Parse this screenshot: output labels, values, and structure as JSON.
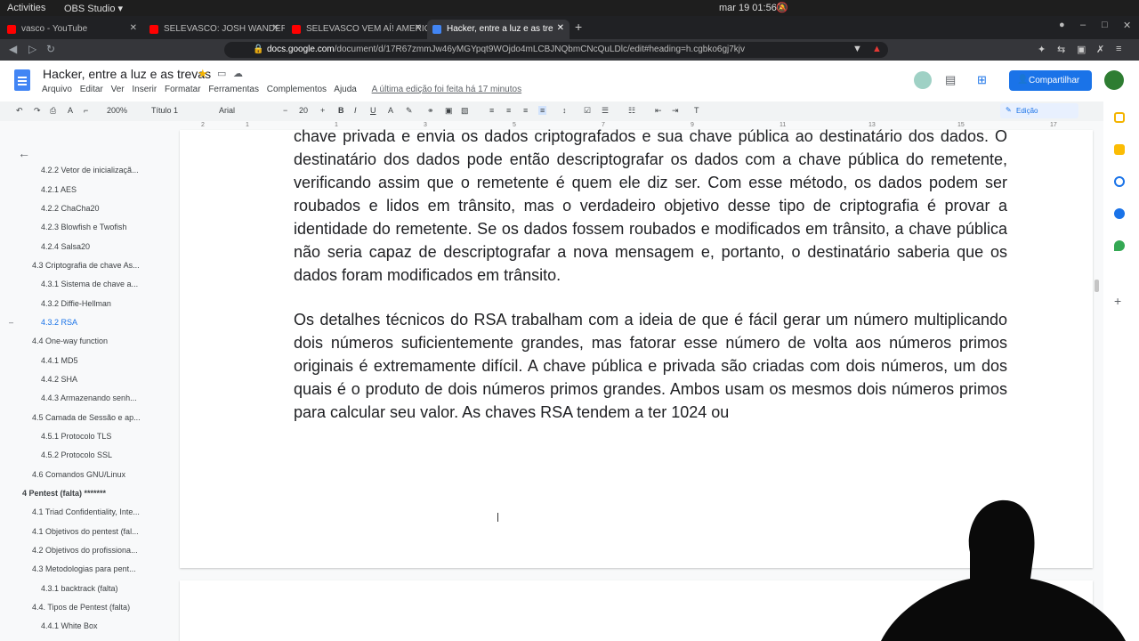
{
  "system": {
    "activities": "Activities",
    "app": "OBS Studio ▾",
    "clock": "mar 19  01:56"
  },
  "tabs": [
    {
      "label": "vasco - YouTube",
      "color": "#ff0000"
    },
    {
      "label": "SELEVASCO: JOSH WANDER",
      "color": "#ff0000"
    },
    {
      "label": "SELEVASCO VEM AÍ! AMERIC",
      "color": "#ff0000"
    },
    {
      "label": "Hacker, entre a luz e as tre",
      "color": "#4285f4"
    }
  ],
  "address": {
    "host": "docs.google.com",
    "path": "/document/d/17R67zmmJw46yMGYpqt9WOjdo4mLCBJNQbmCNcQuLDlc/edit#heading=h.cgbko6gj7kjv"
  },
  "doc": {
    "title": "Hacker, entre a luz e as trevas",
    "menus": [
      "Arquivo",
      "Editar",
      "Ver",
      "Inserir",
      "Formatar",
      "Ferramentas",
      "Complementos",
      "Ajuda"
    ],
    "last_edit": "A última edição foi feita há 17 minutos",
    "share_label": "Compartilhar"
  },
  "toolbar": {
    "zoom": "200%",
    "style": "Título 1",
    "font": "Arial",
    "size": "20",
    "mode": "Edição"
  },
  "outline": [
    {
      "label": "4.2.2 Vetor de inicializaçã...",
      "level": 3
    },
    {
      "label": "4.2.1 AES",
      "level": 3
    },
    {
      "label": "4.2.2 ChaCha20",
      "level": 3
    },
    {
      "label": "4.2.3 Blowfish e Twofish",
      "level": 3
    },
    {
      "label": "4.2.4 Salsa20",
      "level": 3
    },
    {
      "label": "4.3 Criptografia de chave As...",
      "level": 2
    },
    {
      "label": "4.3.1 Sistema de chave a...",
      "level": 3
    },
    {
      "label": "4.3.2 Diffie-Hellman",
      "level": 3
    },
    {
      "label": "4.3.2 RSA",
      "level": 3,
      "selected": true
    },
    {
      "label": "4.4 One-way function",
      "level": 2
    },
    {
      "label": "4.4.1 MD5",
      "level": 3
    },
    {
      "label": "4.4.2 SHA",
      "level": 3
    },
    {
      "label": "4.4.3 Armazenando senh...",
      "level": 3
    },
    {
      "label": "4.5 Camada de Sessão e ap...",
      "level": 2
    },
    {
      "label": "4.5.1 Protocolo TLS",
      "level": 3
    },
    {
      "label": "4.5.2 Protocolo SSL",
      "level": 3
    },
    {
      "label": "4.6 Comandos GNU/Linux",
      "level": 2
    },
    {
      "label": "4 Pentest (falta) *******",
      "level": 1
    },
    {
      "label": "4.1 Triad Confidentiality, Inte...",
      "level": 2
    },
    {
      "label": "4.1 Objetivos do pentest (fal...",
      "level": 2
    },
    {
      "label": "4.2 Objetivos do profissiona...",
      "level": 2
    },
    {
      "label": "4.3 Metodologias para pent...",
      "level": 2
    },
    {
      "label": "4.3.1 backtrack (falta)",
      "level": 3
    },
    {
      "label": "4.4. Tipos de Pentest (falta)",
      "level": 2
    },
    {
      "label": "4.4.1 White Box",
      "level": 3
    }
  ],
  "content": {
    "para1": "chave privada e envia os dados criptografados e sua chave pública ao destinatário dos dados. O destinatário dos dados pode então descriptografar os dados com a chave pública do remetente, verificando assim que o remetente é quem ele diz ser. Com esse método, os dados podem ser roubados e lidos em trânsito, mas o verdadeiro objetivo desse tipo de criptografia é provar a identidade do remetente. Se os dados fossem roubados e modificados em trânsito, a chave pública não seria capaz de descriptografar a nova mensagem e, portanto, o destinatário saberia que os dados foram modificados em trânsito.",
    "para2": "Os detalhes técnicos do RSA trabalham com a ideia de que é fácil gerar um número multiplicando dois números suficientemente grandes, mas fatorar esse número de volta aos números primos originais é extremamente difícil. A chave pública e privada são criadas com dois números, um dos quais é o produto de dois números primos grandes. Ambos usam os mesmos dois números primos para calcular seu valor. As chaves RSA tendem a ter 1024 ou"
  }
}
